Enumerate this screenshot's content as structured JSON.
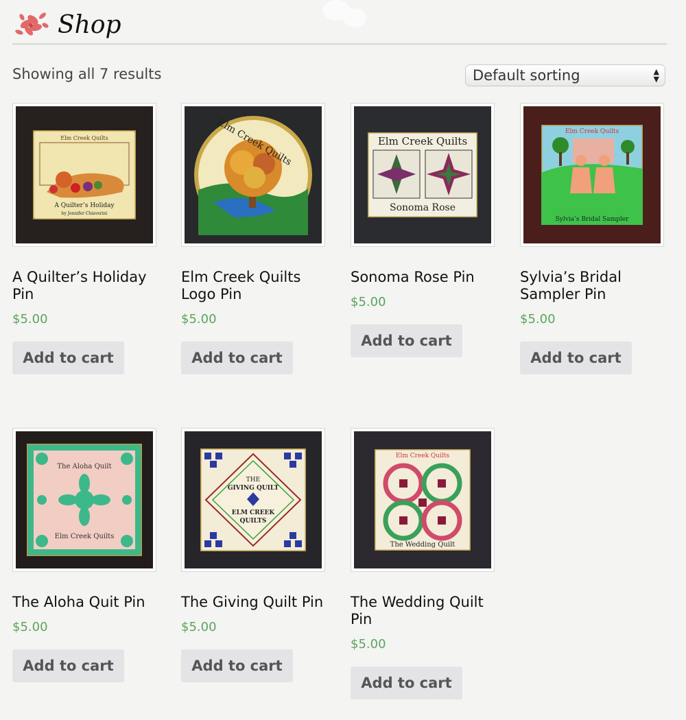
{
  "header": {
    "title": "Shop"
  },
  "toolbar": {
    "result_count": "Showing all 7 results",
    "sort_selected": "Default sorting"
  },
  "products": [
    {
      "name": "A Quilter’s Holiday Pin",
      "price": "$5.00",
      "button": "Add to cart",
      "pin_text": [
        "Elm Creek Quilts",
        "A Quilter’s Holiday",
        "by Jennifer Chiaverini"
      ]
    },
    {
      "name": "Elm Creek Quilts Logo Pin",
      "price": "$5.00",
      "button": "Add to cart",
      "pin_text": [
        "Elm Creek Quilts"
      ]
    },
    {
      "name": "Sonoma Rose Pin",
      "price": "$5.00",
      "button": "Add to cart",
      "pin_text": [
        "Elm Creek Quilts",
        "Sonoma Rose"
      ]
    },
    {
      "name": "Sylvia’s Bridal Sampler Pin",
      "price": "$5.00",
      "button": "Add to cart",
      "pin_text": [
        "Elm Creek Quilts",
        "Sylvia’s Bridal Sampler"
      ]
    },
    {
      "name": "The Aloha Quit Pin",
      "price": "$5.00",
      "button": "Add to cart",
      "pin_text": [
        "The Aloha Quilt",
        "Elm Creek Quilts"
      ]
    },
    {
      "name": "The Giving Quilt Pin",
      "price": "$5.00",
      "button": "Add to cart",
      "pin_text": [
        "THE",
        "GIVING QUILT",
        "ELM CREEK",
        "QUILTS"
      ]
    },
    {
      "name": "The Wedding Quilt Pin",
      "price": "$5.00",
      "button": "Add to cart",
      "pin_text": [
        "Elm Creek Quilts",
        "The Wedding Quilt"
      ]
    }
  ],
  "colors": {
    "price": "#5aa55a",
    "button_bg": "#e4e4e6",
    "logo": "#e06a6a"
  }
}
